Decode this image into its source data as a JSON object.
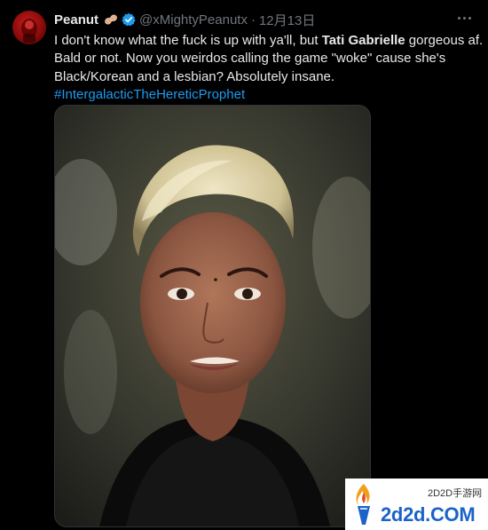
{
  "tweet": {
    "display_name": "Peanut",
    "handle": "@xMightyPeanutx",
    "separator": "·",
    "time": "12月13日",
    "text": {
      "line1_before": "I don't know what the fuck is up with ya'll, but ",
      "line1_bold": "Tati Gabrielle",
      "line1_after": " gorgeous af.",
      "line2": "Bald or not. Now you weirdos calling the game \"woke\" cause she's",
      "line3": "Black/Korean and a lesbian? Absolutely insane.",
      "hashtag": "#IntergalacticTheHereticProphet"
    },
    "icons": {
      "name_emoji": "peanut-icon",
      "verified": "verified-badge-icon",
      "more": "more-options-icon"
    }
  },
  "media": {
    "description_type": "portrait-photo"
  },
  "watermark": {
    "top_text": "2D2D手游网",
    "main_text": "2d2d.COM"
  },
  "colors": {
    "background": "#000000",
    "text": "#e7e9ea",
    "secondary_text": "#71767b",
    "link": "#1d9bf0",
    "verified": "#1d9bf0",
    "watermark_blue": "#1b63c8"
  }
}
